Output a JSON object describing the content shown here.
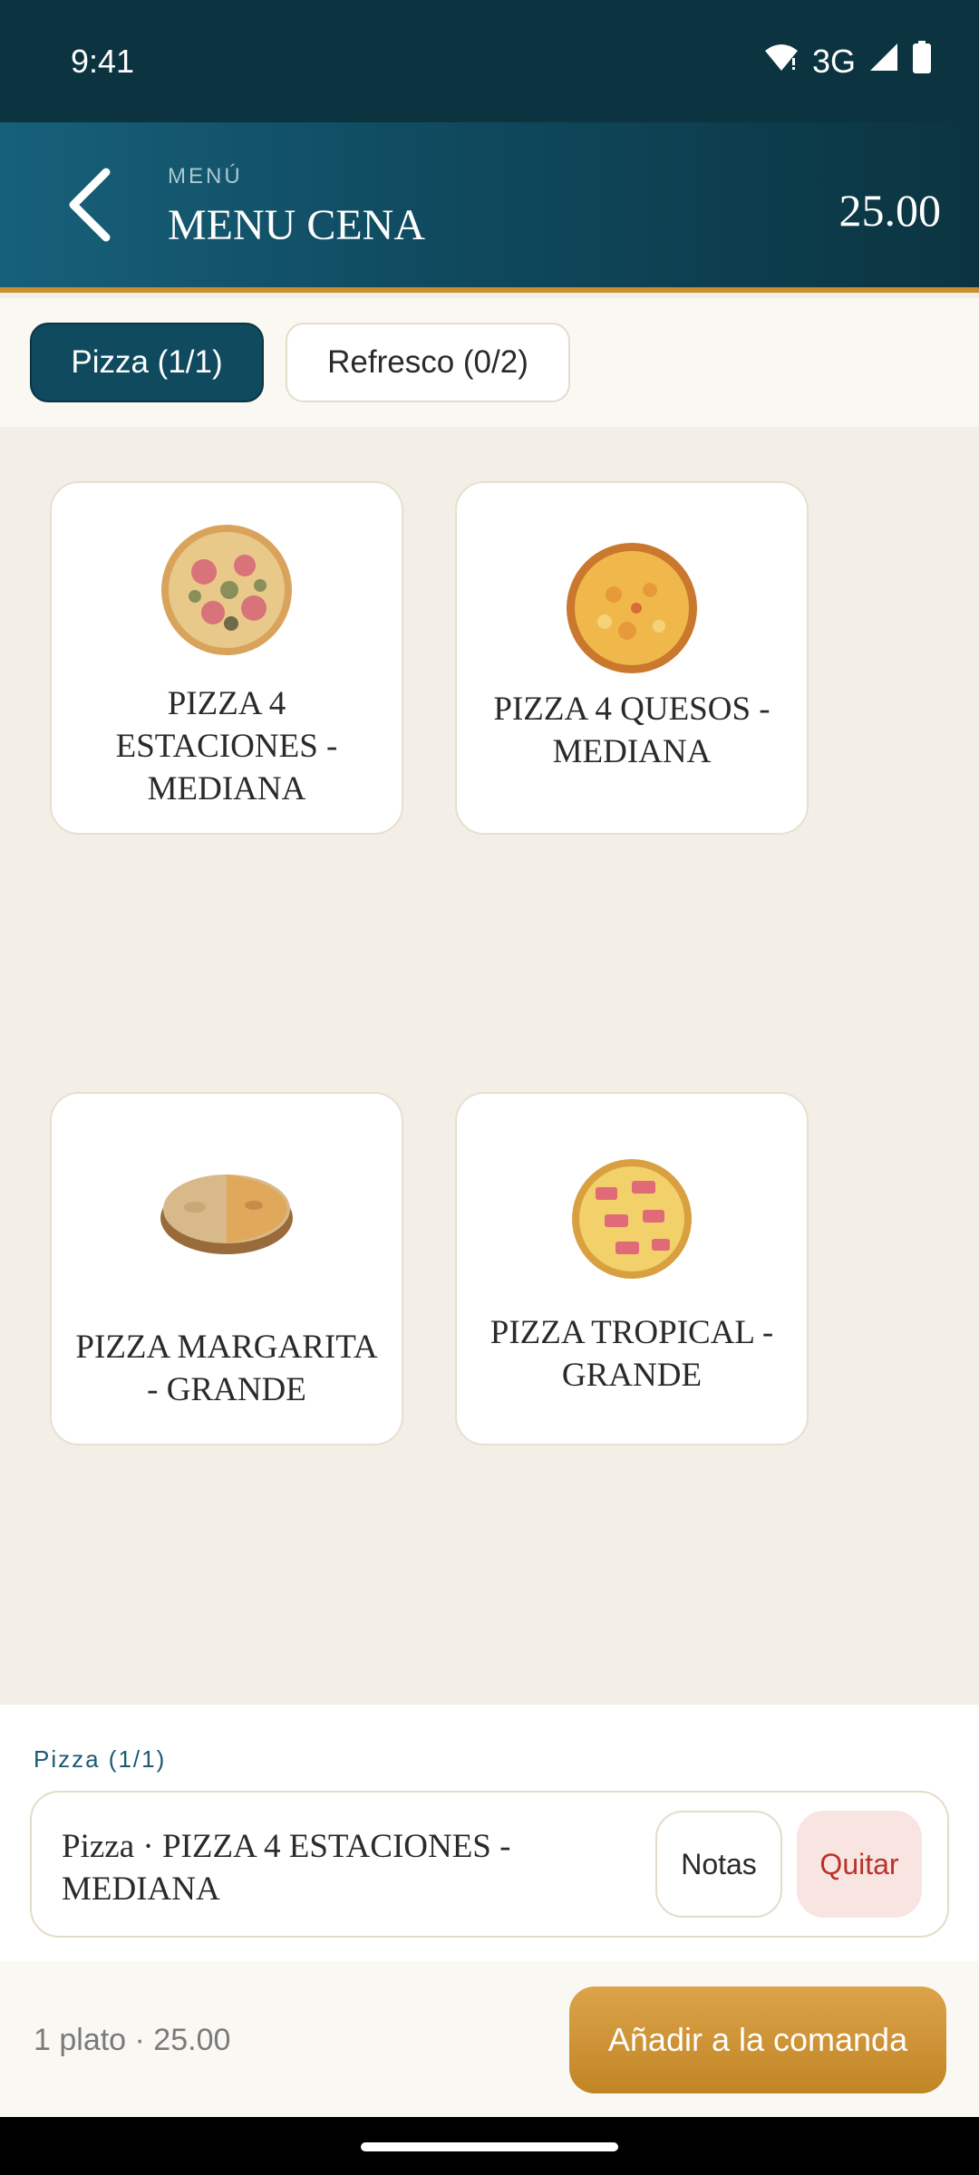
{
  "status_bar": {
    "time": "9:41",
    "network": "3G",
    "icons": [
      "wifi-icon",
      "signal-icon",
      "battery-icon"
    ]
  },
  "header": {
    "subtitle": "MENÚ",
    "title": "MENU CENA",
    "price": "25.00",
    "back_icon": "chevron-left-icon"
  },
  "tabs": [
    {
      "label": "Pizza (1/1)",
      "active": true
    },
    {
      "label": "Refresco (0/2)",
      "active": false
    }
  ],
  "products": [
    {
      "name": "PIZZA 4 ESTACIONES - MEDIANA"
    },
    {
      "name": "PIZZA 4 QUESOS - MEDIANA"
    },
    {
      "name": "PIZZA MARGARITA - GRANDE"
    },
    {
      "name": "PIZZA TROPICAL - GRANDE"
    }
  ],
  "selection": {
    "label": "Pizza (1/1)",
    "item": "Pizza · PIZZA 4 ESTACIONES - MEDIANA",
    "notes_label": "Notas",
    "remove_label": "Quitar"
  },
  "footer": {
    "summary": "1 plato · 25.00",
    "add_label": "Añadir a la comanda"
  },
  "colors": {
    "header_dark": "#0b3340",
    "accent_gold": "#c88f2c",
    "remove_red": "#b8332a"
  }
}
